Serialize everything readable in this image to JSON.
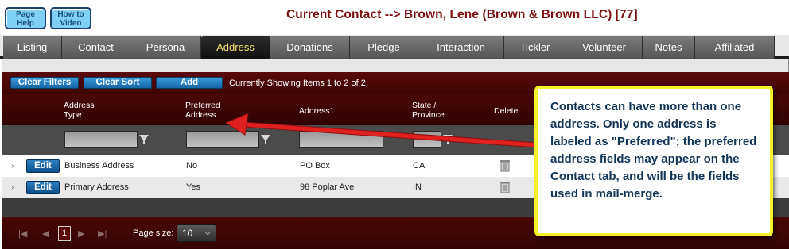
{
  "header": {
    "page_help": [
      "Page",
      "Help"
    ],
    "video_help": [
      "How to",
      "Video"
    ],
    "title": "Current Contact --> Brown, Lene (Brown & Brown LLC) [77]"
  },
  "tabs": [
    "Listing",
    "Contact",
    "Persona",
    "Address",
    "Donations",
    "Pledge",
    "Interaction",
    "Tickler",
    "Volunteer",
    "Notes",
    "Affiliated"
  ],
  "active_tab": "Address",
  "toolbar": {
    "clear_filters": "Clear Filters",
    "clear_sort": "Clear Sort",
    "add": "Add",
    "status": "Currently Showing Items 1 to 2 of 2"
  },
  "columns": {
    "address_type": [
      "Address",
      "Type"
    ],
    "preferred": [
      "Preferred",
      "Address"
    ],
    "address1": "Address1",
    "state": [
      "State /",
      "Province"
    ],
    "delete": "Delete"
  },
  "rows": [
    {
      "edit": "Edit",
      "address_type": "Business Address",
      "preferred": "No",
      "address1": "PO Box",
      "state": "CA"
    },
    {
      "edit": "Edit",
      "address_type": "Primary Address",
      "preferred": "Yes",
      "address1": "98 Poplar Ave",
      "state": "IN"
    }
  ],
  "pager": {
    "current_page": "1",
    "page_size_label": "Page size:",
    "page_size": "10"
  },
  "callout": "Contacts can have more than one address. Only one address is labeled as \"Preferred\"; the preferred address fields may appear on the Contact tab, and will be the fields used in mail-merge.",
  "colors": {
    "title": "#7b1010",
    "grid_header": "#3e0505",
    "active_tab_text": "#f3e06a",
    "callout_border": "#f4f12a",
    "arrow": "#e02020"
  }
}
